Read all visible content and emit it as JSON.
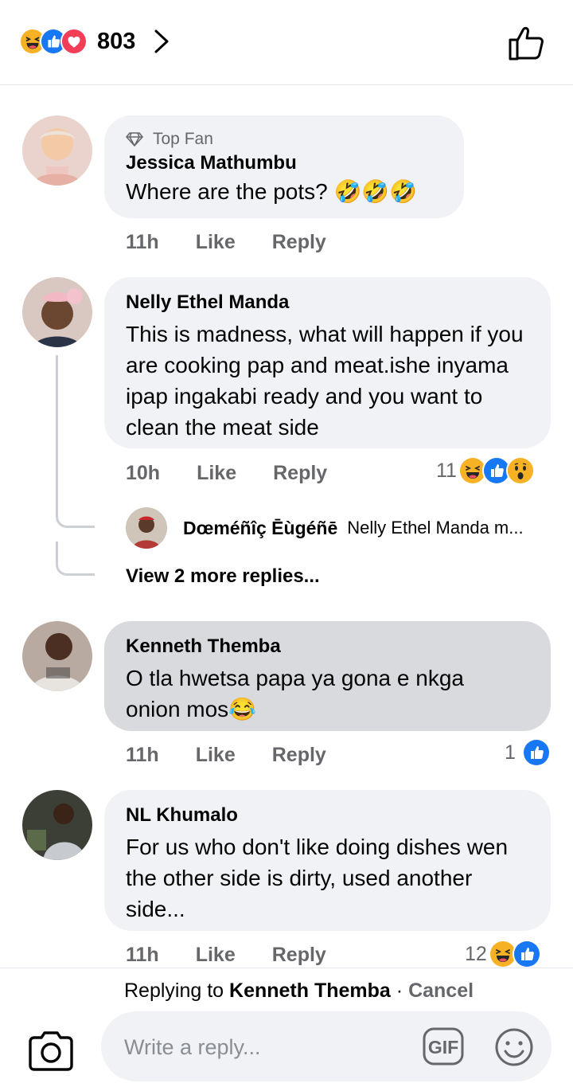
{
  "header": {
    "reaction_count": "803",
    "reaction_icons": [
      "laugh-icon",
      "like-icon",
      "love-icon"
    ]
  },
  "comments": [
    {
      "badge": "Top Fan",
      "name": "Jessica Mathumbu",
      "text": "Where are the pots? 🤣🤣🤣",
      "time": "11h",
      "like": "Like",
      "reply": "Reply"
    },
    {
      "name": "Nelly Ethel Manda",
      "text": "This is madness, what will happen if you are cooking pap and meat.ishe inyama  ipap ingakabi ready and you want to clean the meat side",
      "time": "10h",
      "like": "Like",
      "reply": "Reply",
      "reaction_count": "11",
      "reaction_icons": [
        "laugh-icon",
        "like-icon",
        "wow-icon"
      ],
      "reply_preview": {
        "name": "Dœméñîç Ēùgéñē",
        "snippet": "Nelly Ethel Manda m..."
      },
      "view_more": "View 2 more replies..."
    },
    {
      "name": "Kenneth Themba",
      "text": "O tla hwetsa papa ya gona e nkga onion mos😂",
      "time": "11h",
      "like": "Like",
      "reply": "Reply",
      "reaction_count": "1",
      "reaction_icons": [
        "like-icon"
      ]
    },
    {
      "name": "NL Khumalo",
      "text": "For us who don't like doing dishes wen the other side is dirty, used another side...",
      "time": "11h",
      "like": "Like",
      "reply": "Reply",
      "reaction_count": "12",
      "reaction_icons": [
        "laugh-icon",
        "like-icon"
      ]
    }
  ],
  "composer": {
    "replying_prefix": "Replying to",
    "replying_to": "Kenneth Themba",
    "separator": "·",
    "cancel": "Cancel",
    "placeholder": "Write a reply...",
    "gif_label": "GIF"
  },
  "colors": {
    "like_blue": "#1877f2",
    "love_red": "#f33e58",
    "laugh_yellow": "#f7b125",
    "bubble": "#f0f2f5",
    "bubble_selected": "#d8dade",
    "secondary_text": "#65676b"
  }
}
